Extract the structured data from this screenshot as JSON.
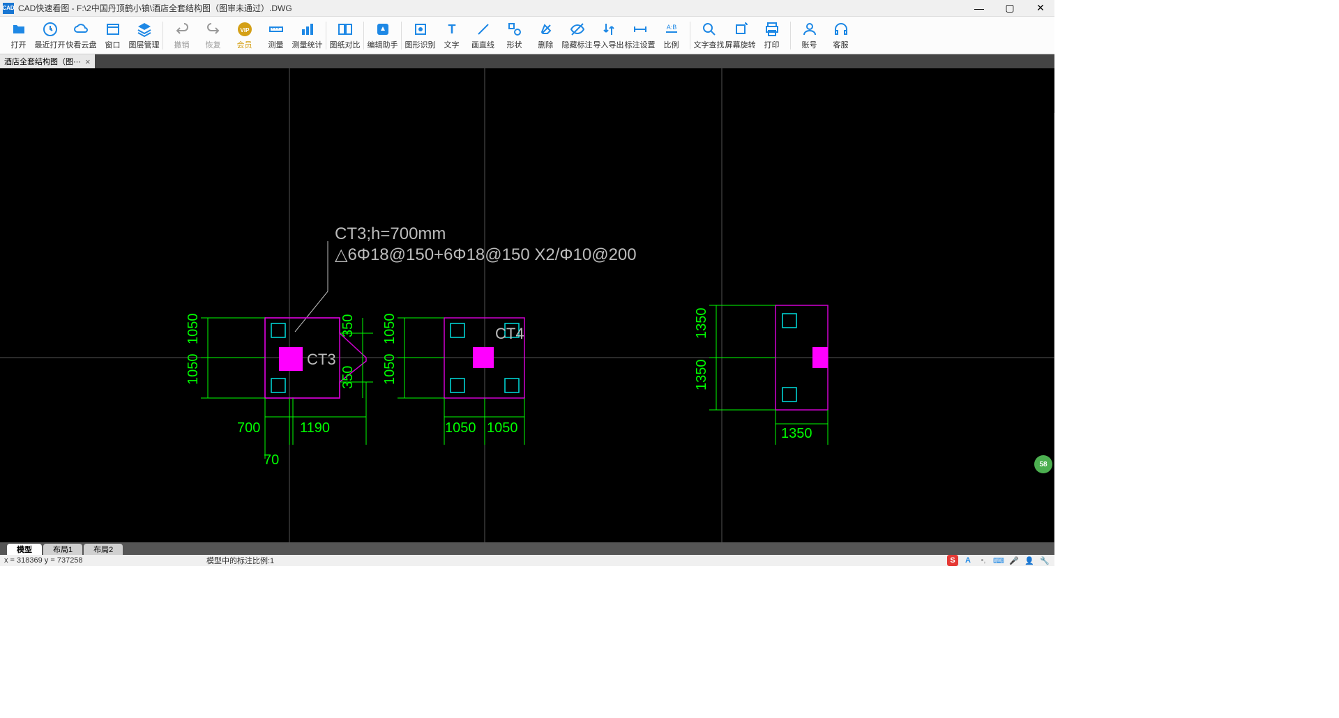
{
  "titlebar": {
    "app_name": "CAD快速看图",
    "file_path": "F:\\2中国丹顶鹤小镇\\酒店全套结构图（图审未通过）.DWG",
    "icon_text": "CAD"
  },
  "toolbar": {
    "open": "打开",
    "recent": "最近打开",
    "cloud": "快看云盘",
    "window": "窗口",
    "layer": "图层管理",
    "undo": "撤销",
    "redo": "恢复",
    "vip": "会员",
    "measure": "测量",
    "measure_stat": "测量统计",
    "compare": "图纸对比",
    "edit_helper": "编辑助手",
    "shape_rec": "图形识别",
    "text": "文字",
    "line": "画直线",
    "shape": "形状",
    "delete": "删除",
    "hide_dim": "隐藏标注",
    "import_export": "导入导出",
    "dim_setting": "标注设置",
    "ratio": "比例",
    "text_search": "文字查找",
    "rotate": "屏幕旋转",
    "print": "打印",
    "account": "账号",
    "service": "客服"
  },
  "file_tabs": {
    "tab1": "酒店全套结构图（图···"
  },
  "cad": {
    "annotation_line1": "CT3;h=700mm",
    "annotation_line2": "△6Φ18@150+6Φ18@150 X2/Φ10@200",
    "ct3_label": "CT3",
    "ct4_label": "CT4",
    "dims": {
      "d1050_1": "1050",
      "d1050_2": "1050",
      "d350_1": "350",
      "d350_2": "350",
      "d700": "700",
      "d1190": "1190",
      "d70": "70",
      "d1050_3": "1050",
      "d1050_4": "1050",
      "d1050_5": "1050",
      "d1050_6": "1050",
      "d1350_1": "1350",
      "d1350_2": "1350",
      "d1350_3": "1350"
    }
  },
  "layout_tabs": {
    "model": "模型",
    "layout1": "布局1",
    "layout2": "布局2"
  },
  "statusbar": {
    "coords": "x = 318369 y = 737258",
    "scale": "模型中的标注比例:1"
  },
  "float_badge": "58"
}
